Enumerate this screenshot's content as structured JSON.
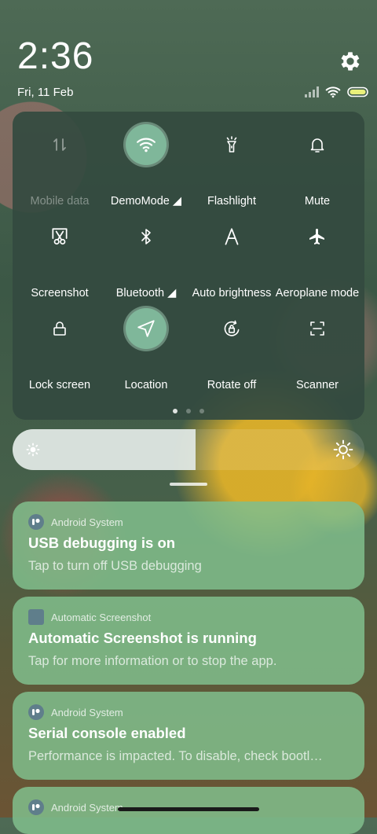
{
  "status": {
    "time": "2:36",
    "date": "Fri, 11 Feb"
  },
  "quick_settings": {
    "tiles": [
      {
        "label": "Mobile data",
        "icon": "mobile-data-icon",
        "active": false,
        "disabled": true
      },
      {
        "label": "DemoMode ◢",
        "icon": "wifi-icon",
        "active": true
      },
      {
        "label": "Flashlight",
        "icon": "flashlight-icon",
        "active": false
      },
      {
        "label": "Mute",
        "icon": "bell-icon",
        "active": false
      },
      {
        "label": "Screenshot",
        "icon": "scissors-icon",
        "active": false
      },
      {
        "label": "Bluetooth ◢",
        "icon": "bluetooth-icon",
        "active": false
      },
      {
        "label": "Auto brightness",
        "icon": "auto-brightness-icon",
        "active": false
      },
      {
        "label": "Aeroplane mode",
        "icon": "airplane-icon",
        "active": false
      },
      {
        "label": "Lock screen",
        "icon": "lock-icon",
        "active": false
      },
      {
        "label": "Location",
        "icon": "location-icon",
        "active": true
      },
      {
        "label": "Rotate off",
        "icon": "rotate-lock-icon",
        "active": false
      },
      {
        "label": "Scanner",
        "icon": "scanner-icon",
        "active": false
      }
    ],
    "page_count": 3,
    "current_page": 1
  },
  "brightness": {
    "level": 0.52
  },
  "notifications": [
    {
      "app": "Android System",
      "icon": "android-system-icon",
      "title": "USB debugging is on",
      "text": "Tap to turn off USB debugging"
    },
    {
      "app": "Automatic Screenshot",
      "icon": "automatic-screenshot-icon",
      "title": "Automatic Screenshot is running",
      "text": "Tap for more information or to stop the app."
    },
    {
      "app": "Android System",
      "icon": "android-system-icon",
      "title": "Serial console enabled",
      "text": "Performance is impacted. To disable, check bootl…"
    },
    {
      "app": "Android System",
      "icon": "android-system-icon",
      "title": "",
      "text": ""
    }
  ]
}
